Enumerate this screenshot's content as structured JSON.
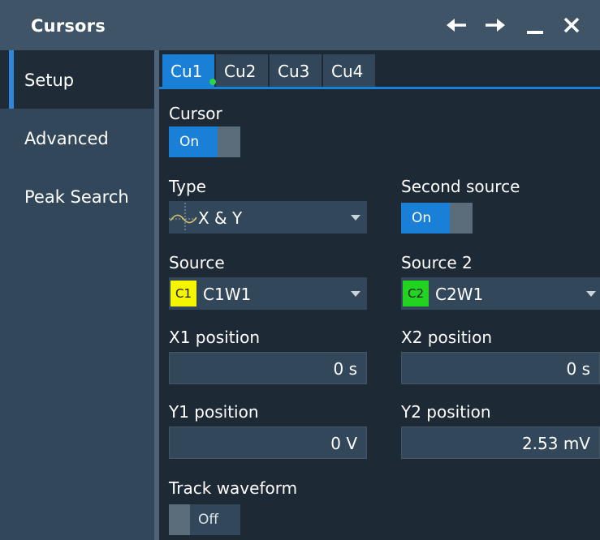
{
  "window": {
    "title": "Cursors"
  },
  "sidebar": {
    "items": [
      {
        "label": "Setup",
        "active": true
      },
      {
        "label": "Advanced",
        "active": false
      },
      {
        "label": "Peak Search",
        "active": false
      }
    ]
  },
  "tabs": [
    {
      "label": "Cu1",
      "active": true
    },
    {
      "label": "Cu2",
      "active": false
    },
    {
      "label": "Cu3",
      "active": false
    },
    {
      "label": "Cu4",
      "active": false
    }
  ],
  "cursor": {
    "label": "Cursor",
    "state": "On"
  },
  "type": {
    "label": "Type",
    "value": "X & Y"
  },
  "second_source": {
    "label": "Second source",
    "state": "On"
  },
  "source": {
    "label": "Source",
    "badge": "C1",
    "badge_color": "#f5f500",
    "value": "C1W1"
  },
  "source2": {
    "label": "Source 2",
    "badge": "C2",
    "badge_color": "#22d41f",
    "value": "C2W1"
  },
  "x1": {
    "label": "X1 position",
    "value": "0 s"
  },
  "x2": {
    "label": "X2 position",
    "value": "0 s"
  },
  "y1": {
    "label": "Y1 position",
    "value": "0 V"
  },
  "y2": {
    "label": "Y2 position",
    "value": "2.53 mV"
  },
  "track": {
    "label": "Track waveform",
    "state": "Off"
  },
  "colors": {
    "accent": "#1a7fd6",
    "titlebar": "#3f5567",
    "panel": "#1d2a35"
  },
  "icons": {
    "back": "arrow-left-icon",
    "forward": "arrow-right-icon",
    "minimize": "minimize-icon",
    "close": "close-icon",
    "type": "xy-cursor-icon"
  }
}
